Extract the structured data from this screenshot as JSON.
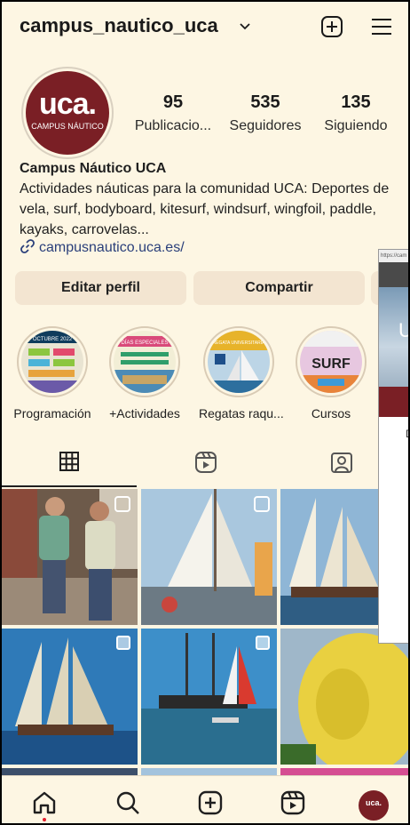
{
  "header": {
    "username": "campus_nautico_uca"
  },
  "profile": {
    "avatar_text": "uca.",
    "avatar_subtext": "CAMPUS NÁUTICO",
    "stats": [
      {
        "value": "95",
        "label": "Publicacio..."
      },
      {
        "value": "535",
        "label": "Seguidores"
      },
      {
        "value": "135",
        "label": "Siguiendo"
      }
    ],
    "name": "Campus Náutico UCA",
    "bio": "Actividades náuticas para la comunidad UCA: Deportes de vela, surf, bodyboard, kitesurf, windsurf, wingfoil, paddle, kayaks, carrovelas...",
    "link": "campusnautico.uca.es/"
  },
  "buttons": {
    "edit": "Editar perfil",
    "share": "Compartir"
  },
  "highlights": [
    {
      "label": "Programación",
      "art": "OCTUBRE 2022"
    },
    {
      "label": "+Actividades",
      "art": "DÍAS ESPECIALES"
    },
    {
      "label": "Regatas raqu...",
      "art": "REGATA UNIVERSITARIA"
    },
    {
      "label": "Cursos",
      "art": "SURF"
    }
  ],
  "overlay": {
    "url": "https://cam",
    "photo_letter": "U",
    "letter": "D"
  },
  "bottom_nav": {
    "profile_badge": "uca."
  },
  "colors": {
    "background": "#fdf6e3",
    "button": "#f3e5d1",
    "brand_maroon": "#7a1f25",
    "link": "#2a3f7a"
  }
}
